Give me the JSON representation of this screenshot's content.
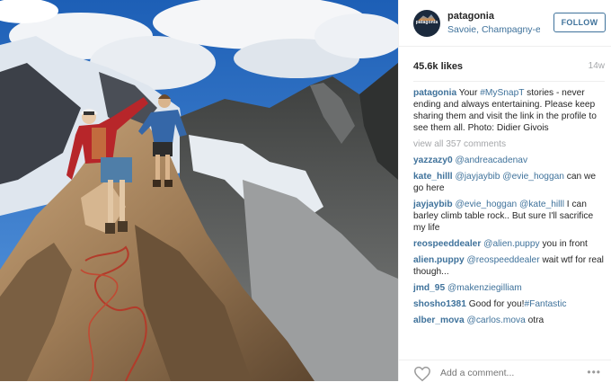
{
  "post": {
    "username": "patagonia",
    "location": "Savoie, Champagny-en-Vanoise",
    "follow_label": "FOLLOW",
    "likes": "45.6k likes",
    "age": "14w",
    "avatar_logo_text": "patagonia",
    "caption": {
      "user": "patagonia",
      "text_before": "Your ",
      "hashtag": "#MySnapT",
      "text_after": " stories - never ending and always entertaining. Please keep sharing them and visit the link in the profile to see them all. Photo: Didier Givois"
    },
    "view_all": "view all 357 comments",
    "comments": [
      {
        "user": "yazzazy0",
        "mention": "@andreacadenav",
        "text": ""
      },
      {
        "user": "kate_hilll",
        "mention": "@jayjaybib @evie_hoggan",
        "text": " can we go here"
      },
      {
        "user": "jayjaybib",
        "mention": "@evie_hoggan @kate_hilll",
        "text": " I can barley climb table rock.. But sure I'll sacrifice my life"
      },
      {
        "user": "reospeeddealer",
        "mention": "@alien.puppy",
        "text": " you in front"
      },
      {
        "user": "alien.puppy",
        "mention": "@reospeeddealer",
        "text": " wait wtf for real though..."
      },
      {
        "user": "jmd_95",
        "mention": "@makenziegilliam",
        "text": ""
      },
      {
        "user": "shosho1381",
        "mention": "",
        "text": "Good for you!",
        "hashtag": "#Fantastic"
      },
      {
        "user": "alber_mova",
        "mention": "@carlos.mova",
        "text": " otra"
      }
    ],
    "add_comment_placeholder": "Add a comment...",
    "more_options": "•••",
    "icons": {
      "like": "heart-icon",
      "more": "more-options-icon"
    },
    "colors": {
      "link": "#3f729b",
      "muted": "#a5a7aa"
    }
  }
}
